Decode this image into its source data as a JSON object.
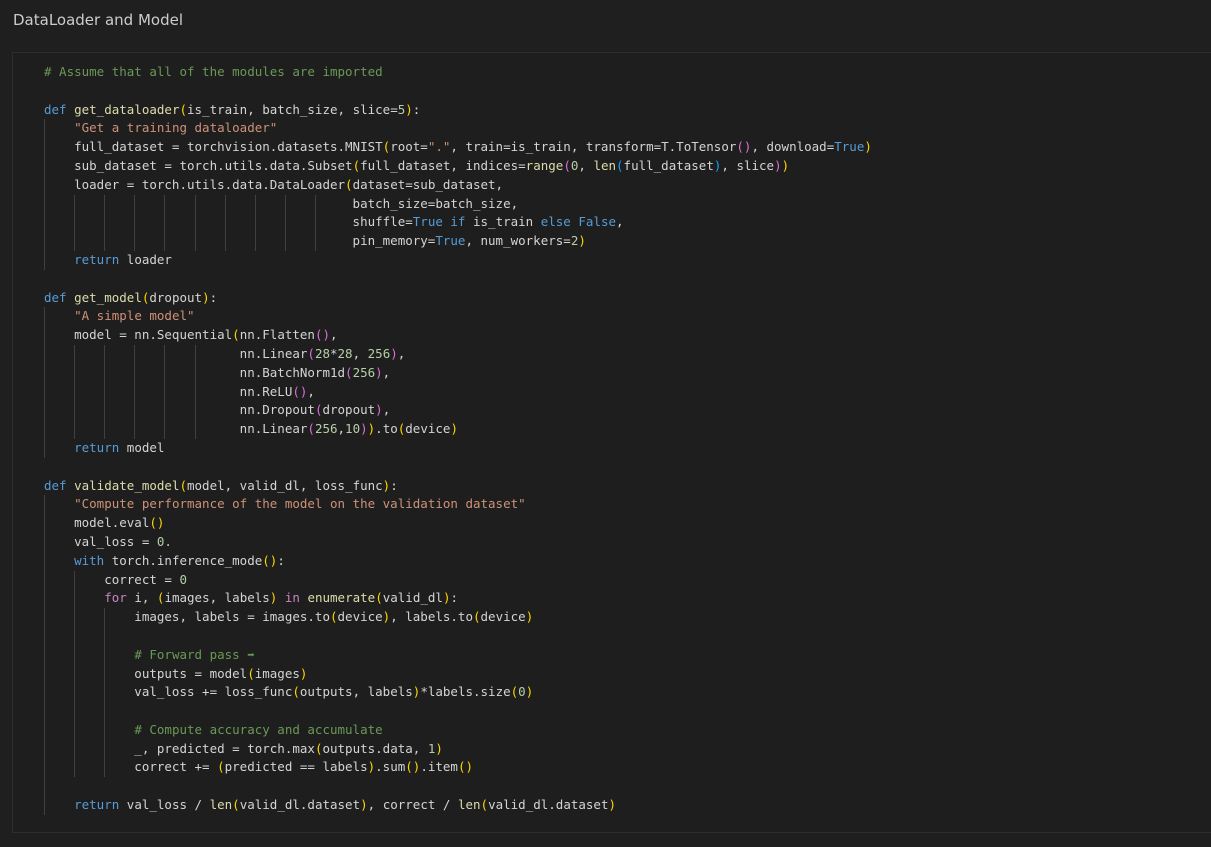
{
  "cell": {
    "title": "DataLoader and Model"
  },
  "code": {
    "language": "python",
    "lines": [
      "# Assume that all of the modules are imported",
      "",
      "def get_dataloader(is_train, batch_size, slice=5):",
      "    \"Get a training dataloader\"",
      "    full_dataset = torchvision.datasets.MNIST(root=\".\", train=is_train, transform=T.ToTensor(), download=True)",
      "    sub_dataset = torch.utils.data.Subset(full_dataset, indices=range(0, len(full_dataset), slice))",
      "    loader = torch.utils.data.DataLoader(dataset=sub_dataset,",
      "                                         batch_size=batch_size,",
      "                                         shuffle=True if is_train else False,",
      "                                         pin_memory=True, num_workers=2)",
      "    return loader",
      "",
      "def get_model(dropout):",
      "    \"A simple model\"",
      "    model = nn.Sequential(nn.Flatten(),",
      "                          nn.Linear(28*28, 256),",
      "                          nn.BatchNorm1d(256),",
      "                          nn.ReLU(),",
      "                          nn.Dropout(dropout),",
      "                          nn.Linear(256,10)).to(device)",
      "    return model",
      "",
      "def validate_model(model, valid_dl, loss_func):",
      "    \"Compute performance of the model on the validation dataset\"",
      "    model.eval()",
      "    val_loss = 0.",
      "    with torch.inference_mode():",
      "        correct = 0",
      "        for i, (images, labels) in enumerate(valid_dl):",
      "            images, labels = images.to(device), labels.to(device)",
      "",
      "            # Forward pass ➡",
      "            outputs = model(images)",
      "            val_loss += loss_func(outputs, labels)*labels.size(0)",
      "",
      "            # Compute accuracy and accumulate",
      "            _, predicted = torch.max(outputs.data, 1)",
      "            correct += (predicted == labels).sum().item()",
      "",
      "    return val_loss / len(valid_dl.dataset), correct / len(valid_dl.dataset)"
    ]
  }
}
